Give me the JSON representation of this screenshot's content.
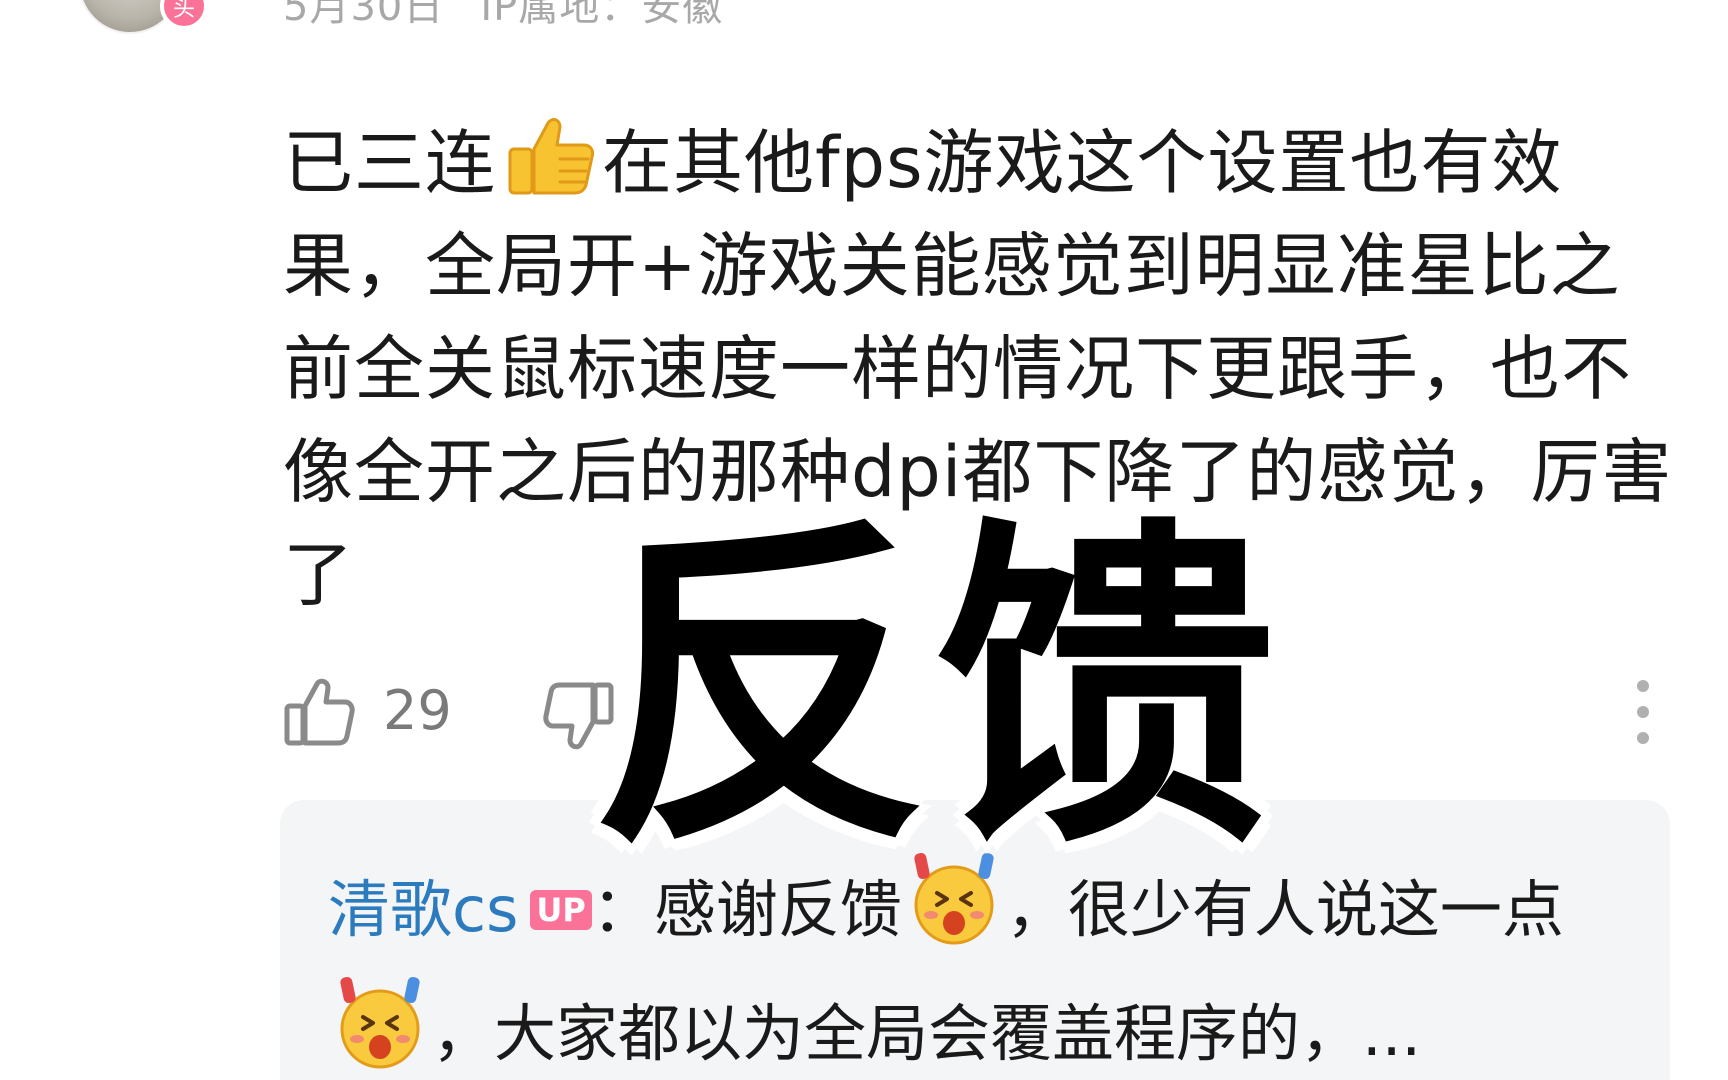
{
  "header": {
    "avatar_badge": "头",
    "date": "5月30日",
    "ip_location": "IP属地：安徽"
  },
  "comment": {
    "text_before_emoji": "已三连",
    "emoji": "thumbs-up",
    "text_after_emoji": "在其他fps游戏这个设置也有效果，全局开+游戏关能感觉到明显准星比之前全关鼠标速度一样的情况下更跟手，也不像全开之后的那种dpi都下降了的感觉，厉害了"
  },
  "actions": {
    "like_count": "29"
  },
  "reply": {
    "author": "清歌cs",
    "badge": "UP",
    "text_part1": "：感谢反馈",
    "text_part2": "，很少有人说这一点",
    "text_part3": "，大家都以为全局会覆盖程序的，..."
  },
  "overlay": {
    "caption": "反馈"
  },
  "colors": {
    "author_blue": "#2c7bbf",
    "badge_pink": "#fb7299",
    "meta_gray": "#a8a8a8",
    "reply_bg": "#f4f5f7"
  }
}
